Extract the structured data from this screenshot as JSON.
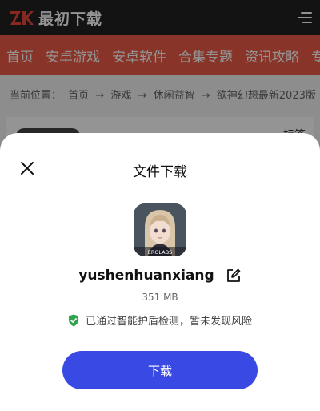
{
  "header": {
    "logo_text": "最初下载",
    "logo_mark": "ZK"
  },
  "nav": {
    "items": [
      {
        "label": "首页"
      },
      {
        "label": "安卓游戏"
      },
      {
        "label": "安卓软件"
      },
      {
        "label": "合集专题"
      },
      {
        "label": "资讯攻略"
      },
      {
        "label": "专"
      }
    ]
  },
  "breadcrumb": {
    "prefix": "当前位置：",
    "items": [
      "首页",
      "→",
      "游戏",
      "→",
      "休闲益智",
      "→",
      "欲神幻想最新2023版"
    ]
  },
  "background_card": {
    "tag": "标签"
  },
  "dialog": {
    "title": "文件下载",
    "app_name": "yushenhuanxiang",
    "icon_caption": "EROLABS",
    "size": "351 MB",
    "security_text": "已通过智能护盾检测，暂未发现风险",
    "download_label": "下载"
  },
  "colors": {
    "header_bg": "#222222",
    "nav_bg": "#ec5b45",
    "accent": "#3849e4",
    "shield": "#2fa54b"
  },
  "icons": {
    "close": "close-icon",
    "edit": "edit-icon",
    "shield": "shield-check-icon",
    "menu": "menu-icon"
  }
}
